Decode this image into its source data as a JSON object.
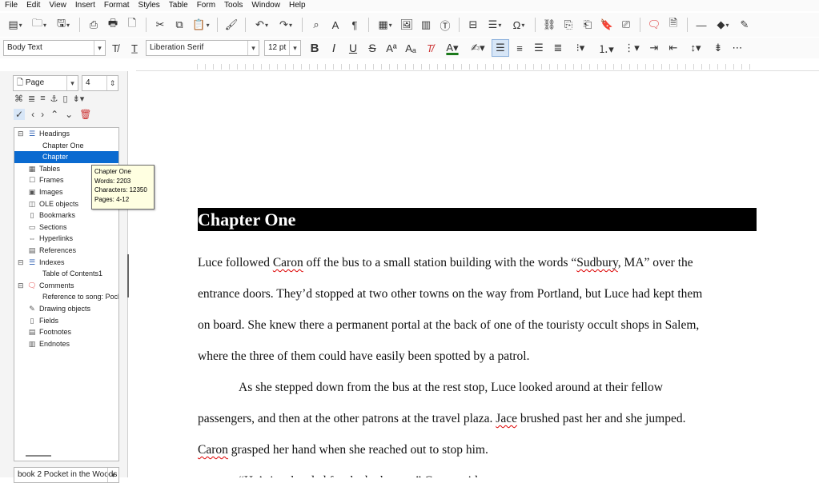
{
  "menubar": {
    "items": [
      "File",
      "Edit",
      "View",
      "Insert",
      "Format",
      "Styles",
      "Table",
      "Form",
      "Tools",
      "Window",
      "Help"
    ]
  },
  "formatting": {
    "paragraph_style": "Body Text",
    "font_name": "Liberation Serif",
    "font_size": "12 pt"
  },
  "navigator": {
    "navigate_by": "Page",
    "page_number": "4",
    "tree": [
      {
        "label": "Headings",
        "expanded": true,
        "icon": "headings-icon"
      },
      {
        "label": "Chapter One",
        "child": true
      },
      {
        "label": "Chapter",
        "child": true,
        "selected": true
      },
      {
        "label": "Tables",
        "icon": "table-icon"
      },
      {
        "label": "Frames",
        "icon": "frame-icon"
      },
      {
        "label": "Images",
        "icon": "image-icon"
      },
      {
        "label": "OLE objects",
        "icon": "ole-icon"
      },
      {
        "label": "Bookmarks",
        "icon": "bookmark-icon"
      },
      {
        "label": "Sections",
        "icon": "section-icon"
      },
      {
        "label": "Hyperlinks",
        "icon": "hyperlink-icon"
      },
      {
        "label": "References",
        "icon": "reference-icon"
      },
      {
        "label": "Indexes",
        "expanded": true,
        "icon": "index-icon"
      },
      {
        "label": "Table of Contents1",
        "child": true
      },
      {
        "label": "Comments",
        "expanded": true,
        "icon": "comment-icon"
      },
      {
        "label": "Reference to song: Pock",
        "child": true
      },
      {
        "label": "Drawing objects",
        "icon": "drawing-icon"
      },
      {
        "label": "Fields",
        "icon": "field-icon"
      },
      {
        "label": "Footnotes",
        "icon": "footnote-icon"
      },
      {
        "label": "Endnotes",
        "icon": "endnote-icon"
      }
    ],
    "document": "book 2 Pocket in the Woods"
  },
  "tooltip": {
    "title": "Chapter One",
    "words": "Words: 2203",
    "characters": "Characters: 12350",
    "pages": "Pages: 4-12"
  },
  "document": {
    "heading": "Chapter One",
    "lines": [
      "Luce followed Caron off the bus to a small station building with the words “Sudbury, MA” over the",
      "entrance doors. They’d stopped at two other towns on the way from Portland, but Luce had kept them",
      "on board. She knew there a permanent portal at the back of one of the touristy occult shops in Salem,",
      "where the three of them could have easily been spotted by a patrol.",
      "As she stepped down from the bus at the rest stop, Luce looked around at their fellow",
      "passengers, and then at the other patrons at the travel plaza. Jace brushed past her and she jumped.",
      "Caron grasped her hand when she reached out to stop him.",
      "“He’s just headed for the bathroom,” Caron said."
    ]
  }
}
